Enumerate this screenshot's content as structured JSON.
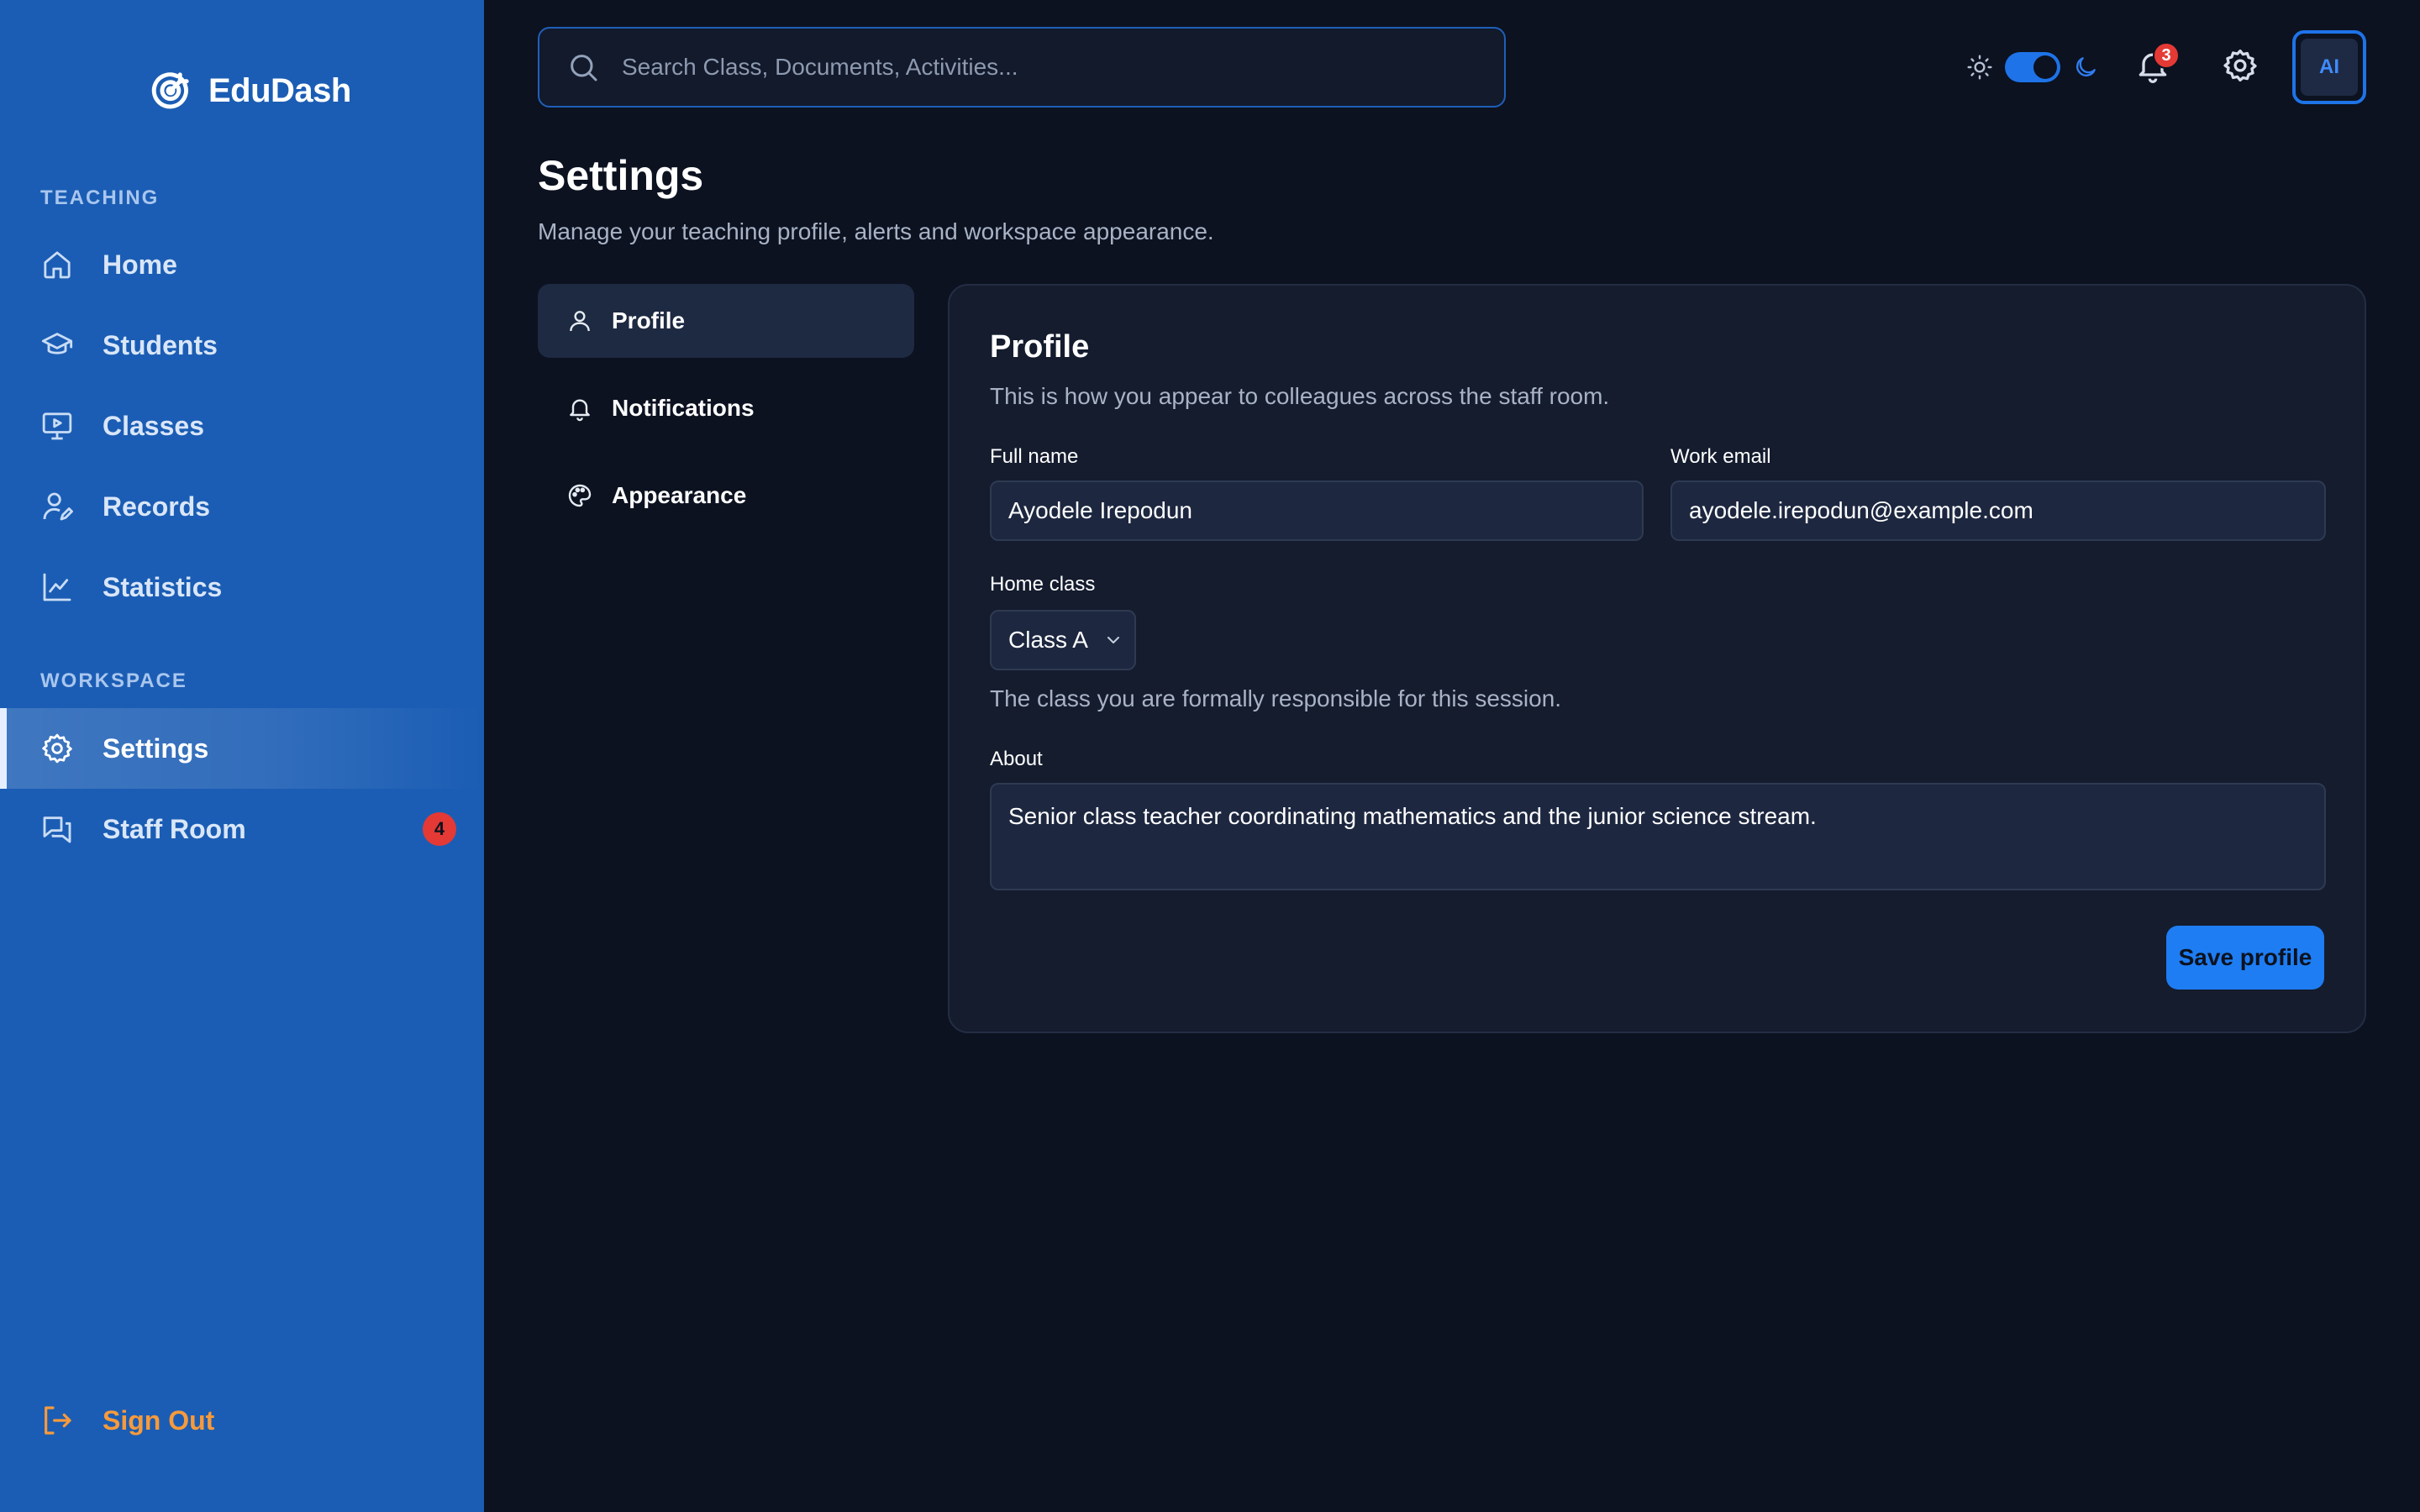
{
  "app": {
    "name": "EduDash",
    "logo_icon": "target-logo-icon"
  },
  "sidebar": {
    "sections": [
      {
        "label": "TEACHING",
        "items": [
          {
            "label": "Home",
            "icon": "home-icon"
          },
          {
            "label": "Students",
            "icon": "graduation-cap-icon"
          },
          {
            "label": "Classes",
            "icon": "presentation-icon"
          },
          {
            "label": "Records",
            "icon": "user-edit-icon"
          },
          {
            "label": "Statistics",
            "icon": "line-chart-icon"
          }
        ]
      },
      {
        "label": "WORKSPACE",
        "items": [
          {
            "label": "Settings",
            "icon": "gear-icon",
            "active": true
          },
          {
            "label": "Staff Room",
            "icon": "chat-icon",
            "badge": "4"
          }
        ]
      }
    ],
    "sign_out": {
      "label": "Sign Out",
      "icon": "logout-icon"
    }
  },
  "topbar": {
    "search": {
      "placeholder": "Search Class, Documents, Activities...",
      "value": ""
    },
    "theme_toggle": {
      "mode": "dark"
    },
    "notifications": {
      "count": "3"
    },
    "avatar": {
      "initials": "AI"
    }
  },
  "page": {
    "title": "Settings",
    "subtitle": "Manage your teaching profile, alerts and workspace appearance."
  },
  "settings_nav": [
    {
      "label": "Profile",
      "icon": "user-icon",
      "active": true
    },
    {
      "label": "Notifications",
      "icon": "bell-icon"
    },
    {
      "label": "Appearance",
      "icon": "palette-icon"
    }
  ],
  "profile": {
    "title": "Profile",
    "description": "This is how you appear to colleagues across the staff room.",
    "full_name": {
      "label": "Full name",
      "value": "Ayodele Irepodun"
    },
    "work_email": {
      "label": "Work email",
      "value": "ayodele.irepodun@example.com"
    },
    "home_class": {
      "label": "Home class",
      "value": "Class A",
      "hint": "The class you are formally responsible for this session."
    },
    "about": {
      "label": "About",
      "value": "Senior class teacher coordinating mathematics and the junior science stream."
    },
    "save_label": "Save profile"
  },
  "colors": {
    "sidebar_bg": "#1b5db4",
    "page_bg": "#0c1220",
    "accent": "#1e7df2",
    "badge": "#e53935",
    "sign_out": "#f79a3c"
  }
}
